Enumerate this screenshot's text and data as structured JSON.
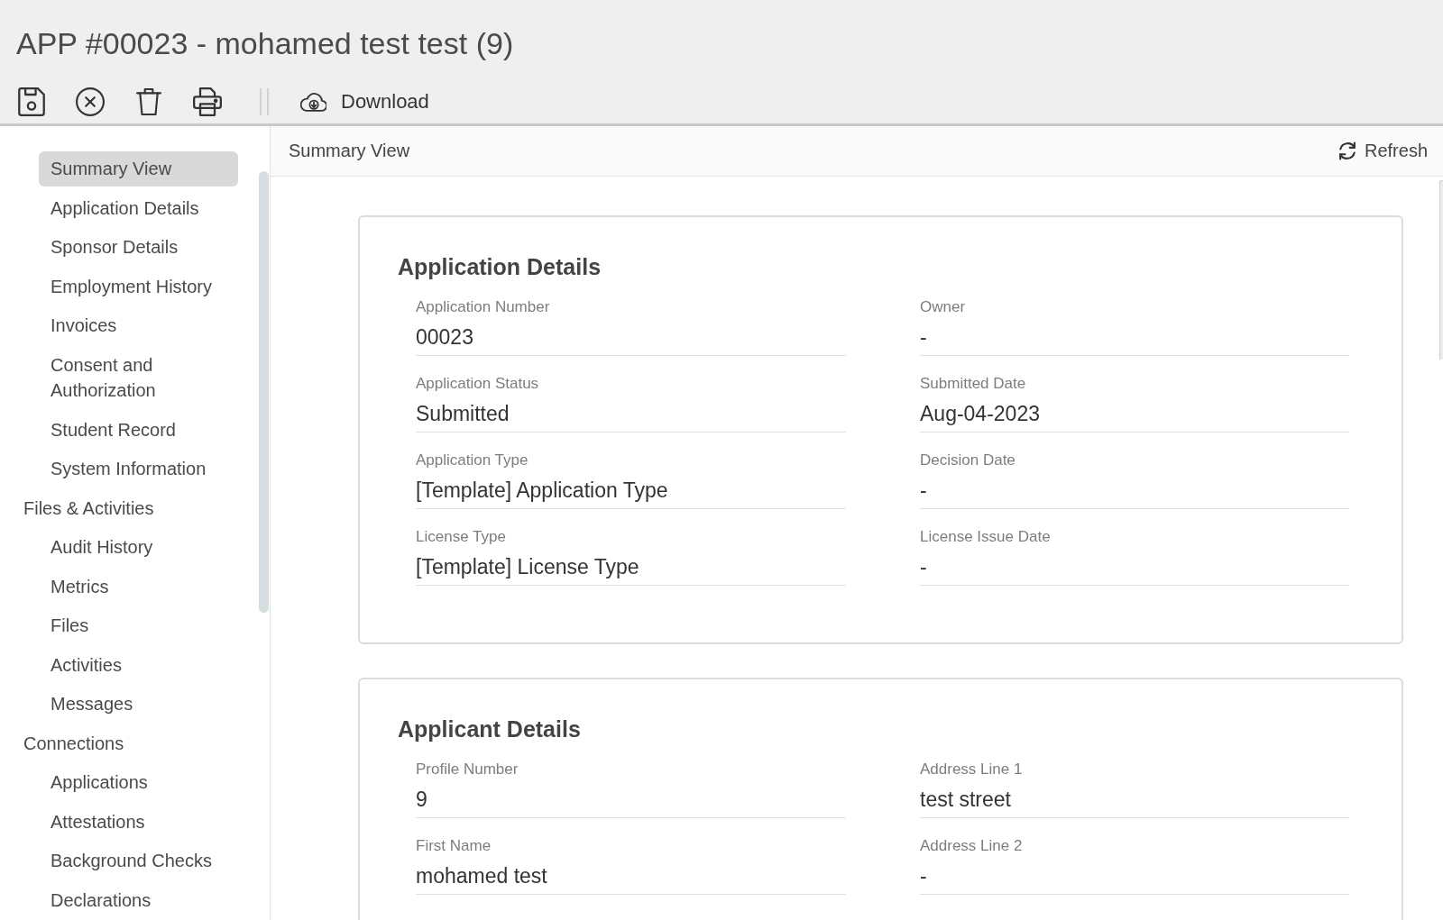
{
  "window": {
    "title": "APP #00023 - mohamed test test (9)"
  },
  "toolbar": {
    "items": [
      {
        "kind": "save"
      },
      {
        "kind": "cancel"
      },
      {
        "kind": "delete"
      },
      {
        "kind": "print"
      },
      {
        "kind": "separator"
      },
      {
        "kind": "download",
        "label": "Download"
      }
    ]
  },
  "sidebar": {
    "sections": [
      {
        "items": [
          {
            "label": "Summary View",
            "selected": true
          },
          {
            "label": "Application Details",
            "selected": false
          },
          {
            "label": "Sponsor Details",
            "selected": false
          },
          {
            "label": "Employment History",
            "selected": false
          },
          {
            "label": "Invoices",
            "selected": false
          },
          {
            "label": "Consent and Authorization",
            "selected": false
          },
          {
            "label": "Student Record",
            "selected": false
          },
          {
            "label": "System Information",
            "selected": false
          }
        ]
      },
      {
        "title": "Files & Activities",
        "items": [
          {
            "label": "Audit History",
            "selected": false
          },
          {
            "label": "Metrics",
            "selected": false
          },
          {
            "label": "Files",
            "selected": false
          },
          {
            "label": "Activities",
            "selected": false
          },
          {
            "label": "Messages",
            "selected": false
          }
        ]
      },
      {
        "title": "Connections",
        "items": [
          {
            "label": "Applications",
            "selected": false
          },
          {
            "label": "Attestations",
            "selected": false
          },
          {
            "label": "Background Checks",
            "selected": false
          },
          {
            "label": "Declarations",
            "selected": false
          }
        ]
      }
    ]
  },
  "content_header": {
    "title": "Summary View",
    "refresh": "Refresh"
  },
  "cards": [
    {
      "title": "Application Details",
      "fields": [
        {
          "label": "Application Number",
          "value": "00023"
        },
        {
          "label": "Owner",
          "value": "-"
        },
        {
          "label": "Application Status",
          "value": "Submitted"
        },
        {
          "label": "Submitted Date",
          "value": "Aug-04-2023"
        },
        {
          "label": "Application Type",
          "value": "[Template] Application Type"
        },
        {
          "label": "Decision Date",
          "value": "-"
        },
        {
          "label": "License Type",
          "value": "[Template] License Type"
        },
        {
          "label": "License Issue Date",
          "value": "-"
        }
      ]
    },
    {
      "title": "Applicant Details",
      "fields": [
        {
          "label": "Profile Number",
          "value": "9"
        },
        {
          "label": "Address Line 1",
          "value": "test street"
        },
        {
          "label": "First Name",
          "value": "mohamed test"
        },
        {
          "label": "Address Line 2",
          "value": "-"
        }
      ]
    }
  ]
}
